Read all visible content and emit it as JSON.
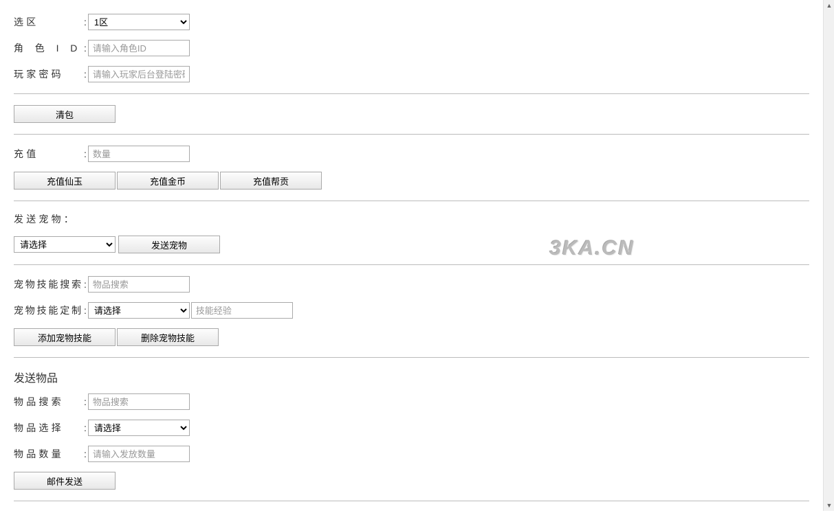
{
  "header": {
    "xuanqu_label": "选区",
    "xuanqu_select": "1区",
    "juese_label": "角色ID",
    "juese_placeholder": "请输入角色ID",
    "mima_label": "玩家密码",
    "mima_placeholder": "请输入玩家后台登陆密码"
  },
  "qingbao": {
    "button": "清包"
  },
  "chongzhi": {
    "label": "充值",
    "placeholder": "数量",
    "btn_xianyu": "充值仙玉",
    "btn_jinbi": "充值金币",
    "btn_bangyin": "充值帮贡"
  },
  "fasongchongwu": {
    "title": "发送宠物：",
    "select": "请选择",
    "button": "发送宠物"
  },
  "chongwujineng": {
    "sousuo_label": "宠物技能搜索",
    "sousuo_placeholder": "物品搜索",
    "dingzhi_label": "宠物技能定制",
    "dingzhi_select": "请选择",
    "dingzhi_placeholder": "技能经验",
    "btn_tianjia": "添加宠物技能",
    "btn_shanchu": "删除宠物技能"
  },
  "fasongwupin": {
    "title": "发送物品",
    "sousuo_label": "物品搜索",
    "sousuo_placeholder": "物品搜索",
    "xuanze_label": "物品选择",
    "xuanze_select": "请选择",
    "shuliang_label": "物品数量",
    "shuliang_placeholder": "请输入发放数量",
    "button": "邮件发送"
  },
  "watermark": "3KA.CN"
}
